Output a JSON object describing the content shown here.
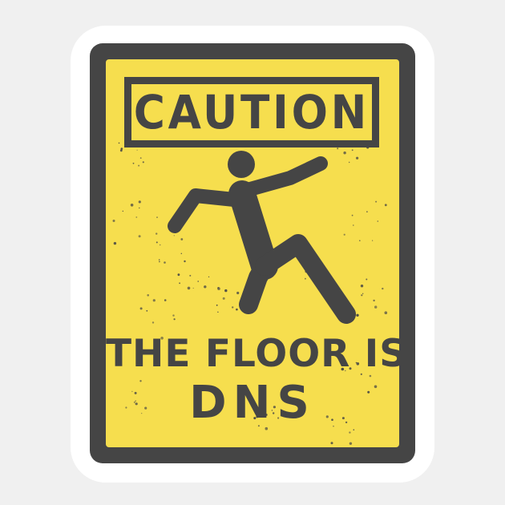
{
  "sign": {
    "header": "CAUTION",
    "line1": "THE FLOOR IS",
    "line2": "DNS"
  },
  "colors": {
    "sign_yellow": "#f6de4e",
    "sign_dark": "#454545",
    "sticker_white": "#ffffff",
    "background": "#f0f0f0"
  },
  "icons": {
    "pictogram": "slipping-person-icon"
  }
}
